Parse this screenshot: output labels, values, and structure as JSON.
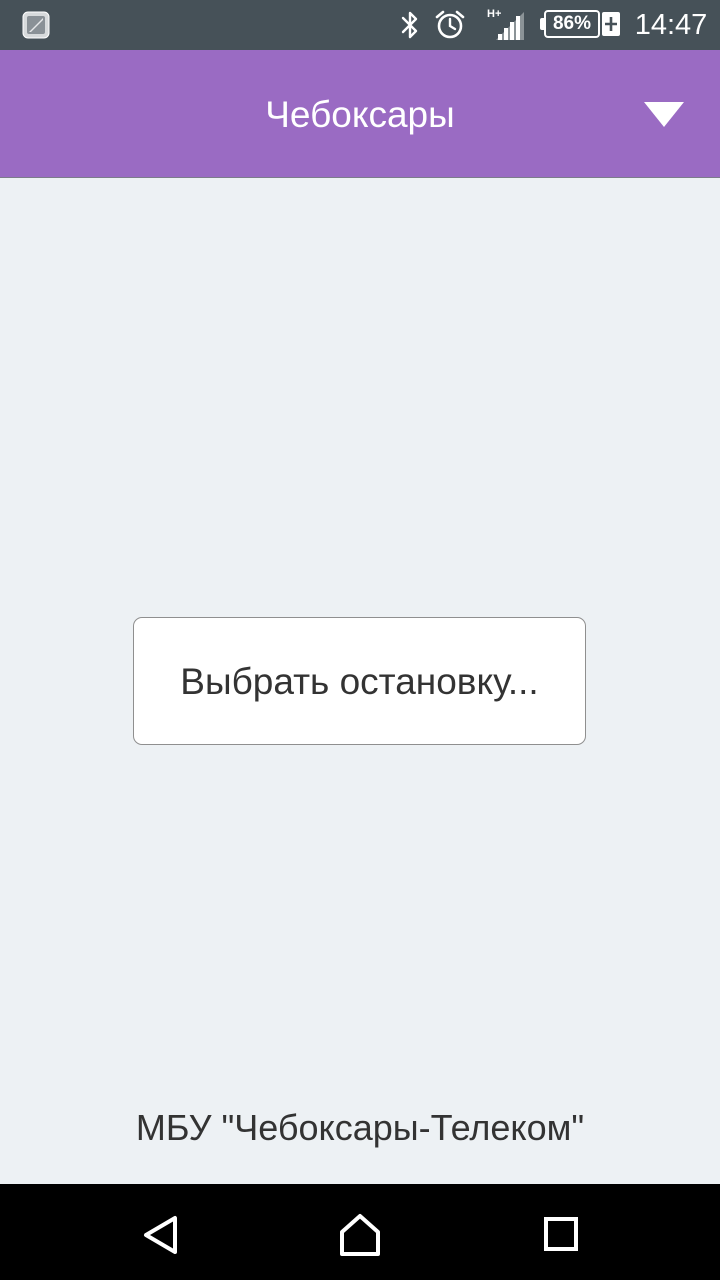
{
  "status_bar": {
    "battery_percent": "86%",
    "time": "14:47",
    "network_type_label": "H+",
    "icons": [
      "app-notification-icon",
      "bluetooth-icon",
      "alarm-icon",
      "signal-icon",
      "battery-icon",
      "charging-plus-icon"
    ]
  },
  "toolbar": {
    "title": "Чебоксары",
    "dropdown_icon": "triangle-down-icon",
    "background_color": "#9a6bc3"
  },
  "main": {
    "choose_stop_label": "Выбрать остановку..."
  },
  "footer": {
    "text": "МБУ \"Чебоксары-Телеком\""
  },
  "nav_bar": {
    "icons": [
      "back-icon",
      "home-icon",
      "recents-icon"
    ]
  }
}
